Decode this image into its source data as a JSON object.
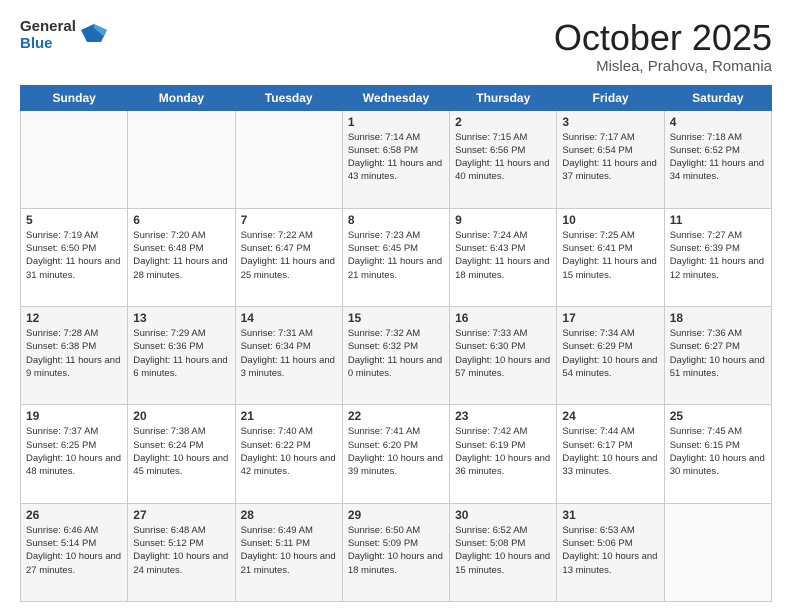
{
  "header": {
    "logo_line1": "General",
    "logo_line2": "Blue",
    "title": "October 2025",
    "subtitle": "Mislea, Prahova, Romania"
  },
  "days_of_week": [
    "Sunday",
    "Monday",
    "Tuesday",
    "Wednesday",
    "Thursday",
    "Friday",
    "Saturday"
  ],
  "weeks": [
    [
      {
        "num": "",
        "sunrise": "",
        "sunset": "",
        "daylight": ""
      },
      {
        "num": "",
        "sunrise": "",
        "sunset": "",
        "daylight": ""
      },
      {
        "num": "",
        "sunrise": "",
        "sunset": "",
        "daylight": ""
      },
      {
        "num": "1",
        "sunrise": "Sunrise: 7:14 AM",
        "sunset": "Sunset: 6:58 PM",
        "daylight": "Daylight: 11 hours and 43 minutes."
      },
      {
        "num": "2",
        "sunrise": "Sunrise: 7:15 AM",
        "sunset": "Sunset: 6:56 PM",
        "daylight": "Daylight: 11 hours and 40 minutes."
      },
      {
        "num": "3",
        "sunrise": "Sunrise: 7:17 AM",
        "sunset": "Sunset: 6:54 PM",
        "daylight": "Daylight: 11 hours and 37 minutes."
      },
      {
        "num": "4",
        "sunrise": "Sunrise: 7:18 AM",
        "sunset": "Sunset: 6:52 PM",
        "daylight": "Daylight: 11 hours and 34 minutes."
      }
    ],
    [
      {
        "num": "5",
        "sunrise": "Sunrise: 7:19 AM",
        "sunset": "Sunset: 6:50 PM",
        "daylight": "Daylight: 11 hours and 31 minutes."
      },
      {
        "num": "6",
        "sunrise": "Sunrise: 7:20 AM",
        "sunset": "Sunset: 6:48 PM",
        "daylight": "Daylight: 11 hours and 28 minutes."
      },
      {
        "num": "7",
        "sunrise": "Sunrise: 7:22 AM",
        "sunset": "Sunset: 6:47 PM",
        "daylight": "Daylight: 11 hours and 25 minutes."
      },
      {
        "num": "8",
        "sunrise": "Sunrise: 7:23 AM",
        "sunset": "Sunset: 6:45 PM",
        "daylight": "Daylight: 11 hours and 21 minutes."
      },
      {
        "num": "9",
        "sunrise": "Sunrise: 7:24 AM",
        "sunset": "Sunset: 6:43 PM",
        "daylight": "Daylight: 11 hours and 18 minutes."
      },
      {
        "num": "10",
        "sunrise": "Sunrise: 7:25 AM",
        "sunset": "Sunset: 6:41 PM",
        "daylight": "Daylight: 11 hours and 15 minutes."
      },
      {
        "num": "11",
        "sunrise": "Sunrise: 7:27 AM",
        "sunset": "Sunset: 6:39 PM",
        "daylight": "Daylight: 11 hours and 12 minutes."
      }
    ],
    [
      {
        "num": "12",
        "sunrise": "Sunrise: 7:28 AM",
        "sunset": "Sunset: 6:38 PM",
        "daylight": "Daylight: 11 hours and 9 minutes."
      },
      {
        "num": "13",
        "sunrise": "Sunrise: 7:29 AM",
        "sunset": "Sunset: 6:36 PM",
        "daylight": "Daylight: 11 hours and 6 minutes."
      },
      {
        "num": "14",
        "sunrise": "Sunrise: 7:31 AM",
        "sunset": "Sunset: 6:34 PM",
        "daylight": "Daylight: 11 hours and 3 minutes."
      },
      {
        "num": "15",
        "sunrise": "Sunrise: 7:32 AM",
        "sunset": "Sunset: 6:32 PM",
        "daylight": "Daylight: 11 hours and 0 minutes."
      },
      {
        "num": "16",
        "sunrise": "Sunrise: 7:33 AM",
        "sunset": "Sunset: 6:30 PM",
        "daylight": "Daylight: 10 hours and 57 minutes."
      },
      {
        "num": "17",
        "sunrise": "Sunrise: 7:34 AM",
        "sunset": "Sunset: 6:29 PM",
        "daylight": "Daylight: 10 hours and 54 minutes."
      },
      {
        "num": "18",
        "sunrise": "Sunrise: 7:36 AM",
        "sunset": "Sunset: 6:27 PM",
        "daylight": "Daylight: 10 hours and 51 minutes."
      }
    ],
    [
      {
        "num": "19",
        "sunrise": "Sunrise: 7:37 AM",
        "sunset": "Sunset: 6:25 PM",
        "daylight": "Daylight: 10 hours and 48 minutes."
      },
      {
        "num": "20",
        "sunrise": "Sunrise: 7:38 AM",
        "sunset": "Sunset: 6:24 PM",
        "daylight": "Daylight: 10 hours and 45 minutes."
      },
      {
        "num": "21",
        "sunrise": "Sunrise: 7:40 AM",
        "sunset": "Sunset: 6:22 PM",
        "daylight": "Daylight: 10 hours and 42 minutes."
      },
      {
        "num": "22",
        "sunrise": "Sunrise: 7:41 AM",
        "sunset": "Sunset: 6:20 PM",
        "daylight": "Daylight: 10 hours and 39 minutes."
      },
      {
        "num": "23",
        "sunrise": "Sunrise: 7:42 AM",
        "sunset": "Sunset: 6:19 PM",
        "daylight": "Daylight: 10 hours and 36 minutes."
      },
      {
        "num": "24",
        "sunrise": "Sunrise: 7:44 AM",
        "sunset": "Sunset: 6:17 PM",
        "daylight": "Daylight: 10 hours and 33 minutes."
      },
      {
        "num": "25",
        "sunrise": "Sunrise: 7:45 AM",
        "sunset": "Sunset: 6:15 PM",
        "daylight": "Daylight: 10 hours and 30 minutes."
      }
    ],
    [
      {
        "num": "26",
        "sunrise": "Sunrise: 6:46 AM",
        "sunset": "Sunset: 5:14 PM",
        "daylight": "Daylight: 10 hours and 27 minutes."
      },
      {
        "num": "27",
        "sunrise": "Sunrise: 6:48 AM",
        "sunset": "Sunset: 5:12 PM",
        "daylight": "Daylight: 10 hours and 24 minutes."
      },
      {
        "num": "28",
        "sunrise": "Sunrise: 6:49 AM",
        "sunset": "Sunset: 5:11 PM",
        "daylight": "Daylight: 10 hours and 21 minutes."
      },
      {
        "num": "29",
        "sunrise": "Sunrise: 6:50 AM",
        "sunset": "Sunset: 5:09 PM",
        "daylight": "Daylight: 10 hours and 18 minutes."
      },
      {
        "num": "30",
        "sunrise": "Sunrise: 6:52 AM",
        "sunset": "Sunset: 5:08 PM",
        "daylight": "Daylight: 10 hours and 15 minutes."
      },
      {
        "num": "31",
        "sunrise": "Sunrise: 6:53 AM",
        "sunset": "Sunset: 5:06 PM",
        "daylight": "Daylight: 10 hours and 13 minutes."
      },
      {
        "num": "",
        "sunrise": "",
        "sunset": "",
        "daylight": ""
      }
    ]
  ]
}
